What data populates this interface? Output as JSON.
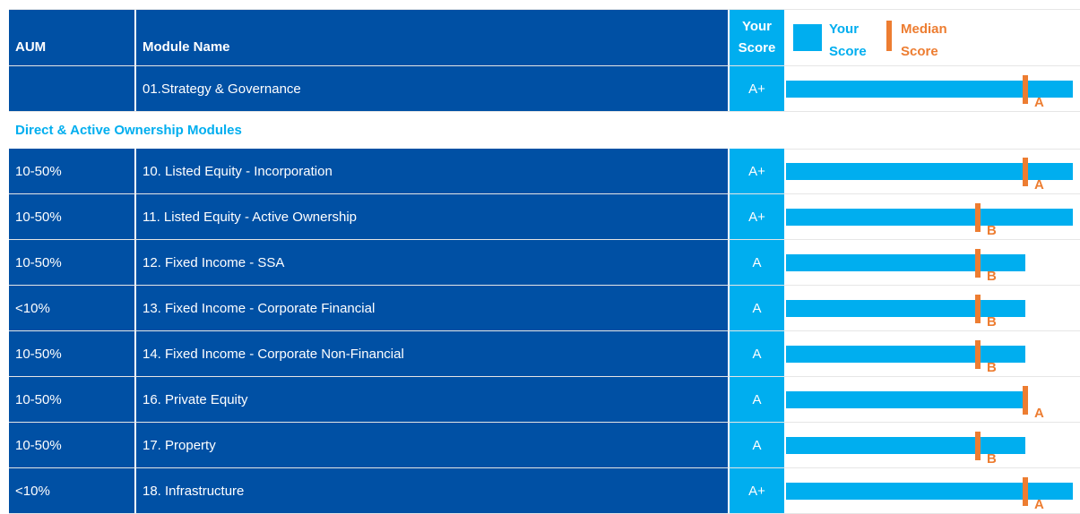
{
  "header": {
    "aum_label": "AUM",
    "module_label": "Module Name",
    "score_line1": "Your",
    "score_line2": "Score"
  },
  "legend": {
    "your_line1": "Your",
    "your_line2": "Score",
    "median_line1": "Median",
    "median_line2": "Score"
  },
  "section_label": "Direct & Active Ownership Modules",
  "colors": {
    "dark_blue": "#0050a4",
    "light_blue": "#00aeef",
    "orange": "#ed7d31"
  },
  "chart_data": {
    "type": "bar",
    "categories": [
      "01.Strategy & Governance",
      "10. Listed Equity - Incorporation",
      "11. Listed Equity - Active Ownership",
      "12. Fixed Income - SSA",
      "13. Fixed Income - Corporate Financial",
      "14. Fixed Income - Corporate Non-Financial",
      "16. Private Equity",
      "17. Property",
      "18. Infrastructure"
    ],
    "aum": [
      "",
      "10-50%",
      "10-50%",
      "10-50%",
      "<10%",
      "10-50%",
      "10-50%",
      "10-50%",
      "<10%"
    ],
    "your_score": [
      "A+",
      "A+",
      "A+",
      "A",
      "A",
      "A",
      "A",
      "A",
      "A+"
    ],
    "median_score": [
      "A",
      "A",
      "B",
      "B",
      "B",
      "B",
      "A",
      "B",
      "A"
    ],
    "grade_scale": [
      "E",
      "D",
      "C",
      "B",
      "A",
      "A+"
    ]
  }
}
